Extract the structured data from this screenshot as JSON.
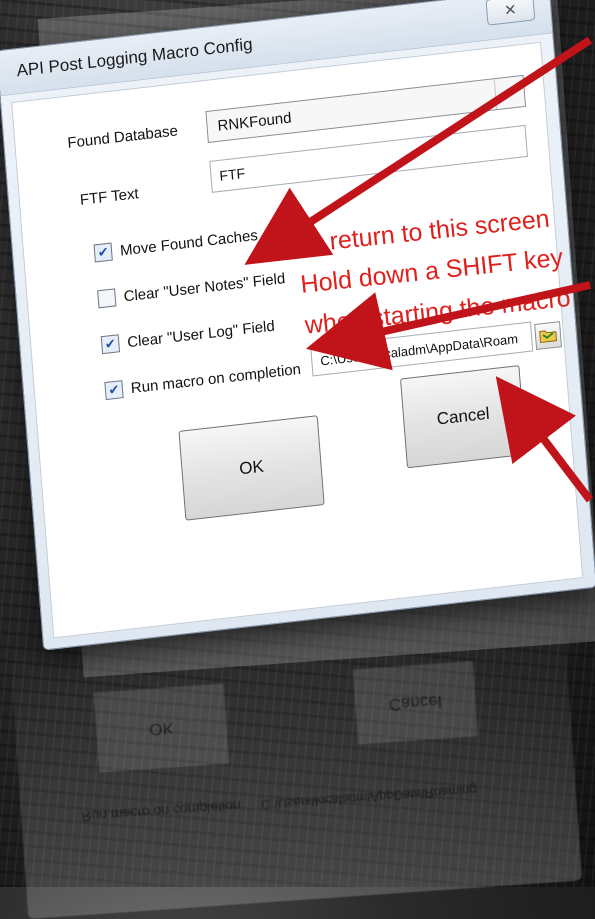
{
  "window": {
    "title": "API Post Logging Macro Config",
    "close_glyph": "✕"
  },
  "fields": {
    "found_database_label": "Found Database",
    "found_database_value": "RNKFound",
    "ftf_text_label": "FTF Text",
    "ftf_text_value": "FTF",
    "macro_path_value": "C:\\Users\\localadm\\AppData\\Roam"
  },
  "checkboxes": [
    {
      "label": "Move Found Caches",
      "checked": true
    },
    {
      "label": "Clear \"User Notes\" Field",
      "checked": false
    },
    {
      "label": "Clear \"User Log\" Field",
      "checked": true
    },
    {
      "label": "Run macro on completion",
      "checked": true
    }
  ],
  "buttons": {
    "ok_label": "OK",
    "cancel_label": "Cancel"
  },
  "annotation": {
    "line1": "To return to this screen",
    "line2": "Hold down a SHIFT key",
    "line3": "when starting the macro"
  },
  "reflection": {
    "ok_label": "OK",
    "cancel_label": "Cancel",
    "path_value": "C:\\Users\\localadm\\AppData\\Roaming",
    "run_macro_label": "Run macro on completion"
  },
  "colors": {
    "annotation_red": "#e0201c",
    "checkbox_mark": "#1c4fa0"
  }
}
